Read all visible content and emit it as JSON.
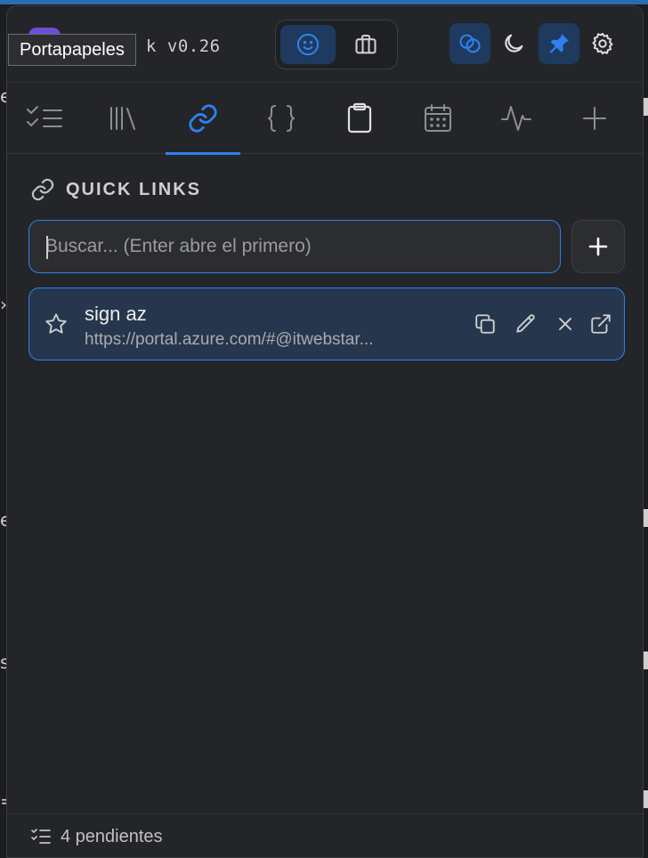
{
  "app": {
    "brand_suffix": "k v0.26",
    "tooltip": "Portapapeles"
  },
  "header": {
    "mode_buttons": [
      {
        "icon": "smile-icon",
        "active": true
      },
      {
        "icon": "briefcase-icon",
        "active": false
      }
    ],
    "buttons": [
      {
        "icon": "overlap-circles-icon",
        "active": true
      },
      {
        "icon": "moon-icon",
        "active": false
      },
      {
        "icon": "pin-icon",
        "active": true
      },
      {
        "icon": "gear-icon",
        "active": false
      }
    ]
  },
  "tabs": [
    {
      "icon": "checklist-icon",
      "active": false
    },
    {
      "icon": "library-icon",
      "active": false
    },
    {
      "icon": "link-icon",
      "active": true
    },
    {
      "icon": "braces-icon",
      "active": false
    },
    {
      "icon": "clipboard-icon",
      "active": false
    },
    {
      "icon": "calendar-icon",
      "active": false
    },
    {
      "icon": "activity-icon",
      "active": false
    },
    {
      "icon": "plus-icon",
      "active": false
    }
  ],
  "section": {
    "title": "QUICK LINKS"
  },
  "search": {
    "placeholder": "Buscar... (Enter abre el primero)",
    "value": ""
  },
  "links": [
    {
      "title": "sign az",
      "url": "https://portal.azure.com/#@itwebstar..."
    }
  ],
  "footer": {
    "status": "4 pendientes"
  },
  "colors": {
    "accent": "#2f80ed",
    "panel": "#242528",
    "active_bg": "#1e3a5f"
  }
}
